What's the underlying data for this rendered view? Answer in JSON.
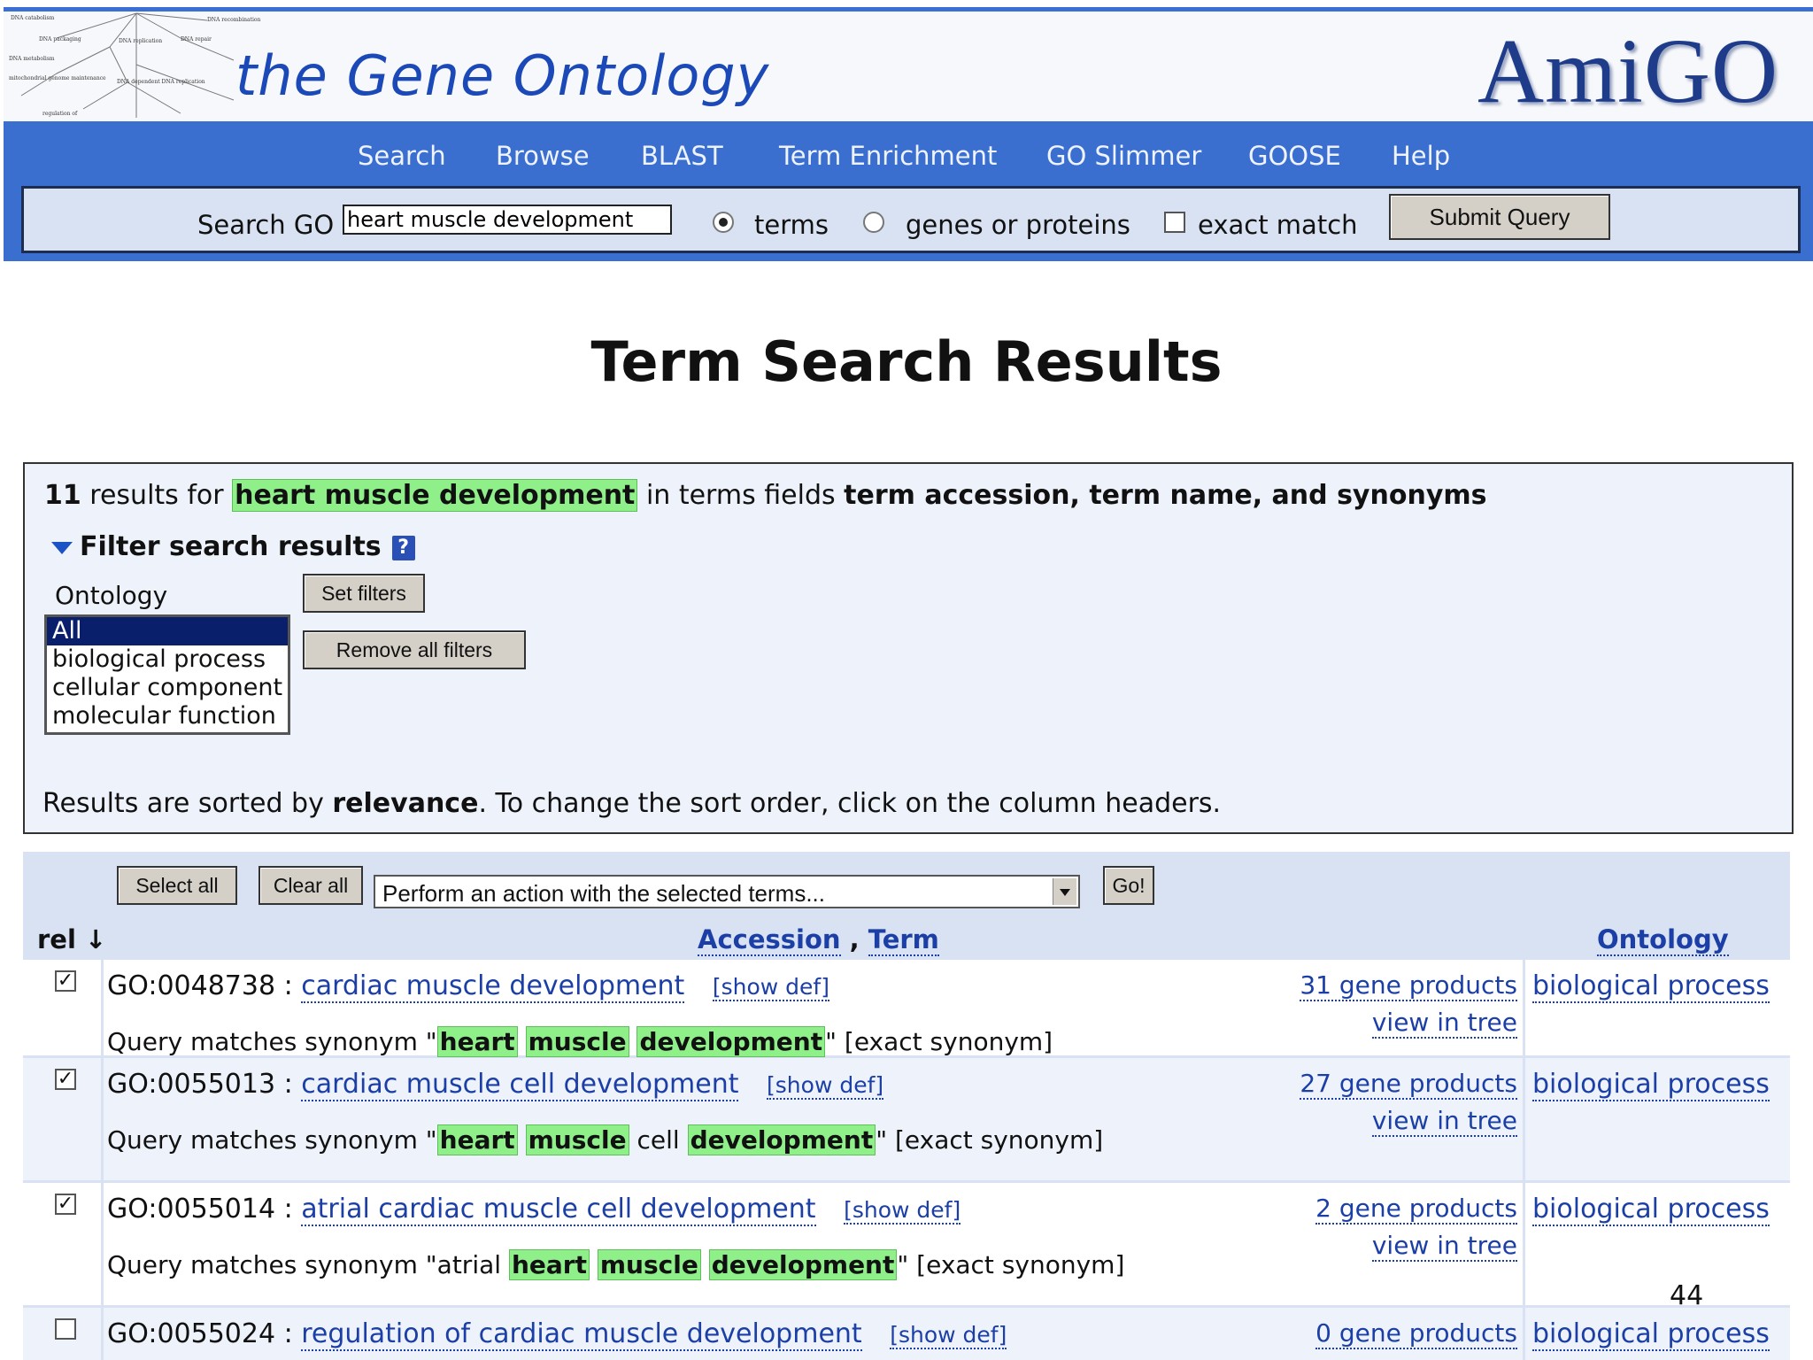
{
  "header": {
    "site_title": "the Gene Ontology",
    "logo": "AmiGO",
    "tree_labels": [
      "DNA catabolism",
      "DNA packaging",
      "DNA replication",
      "DNA metabolism",
      "DNA repair",
      "DNA recombination",
      "mitochondrial genome maintenance",
      "DNA dependent DNA replication",
      "regulation of"
    ]
  },
  "nav": [
    "Search",
    "Browse",
    "BLAST",
    "Term Enrichment",
    "GO Slimmer",
    "GOOSE",
    "Help"
  ],
  "search": {
    "label": "Search GO",
    "query": "heart muscle development",
    "opt_terms": "terms",
    "opt_genes": "genes or proteins",
    "opt_exact": "exact match",
    "submit": "Submit Query"
  },
  "page_title": "Term Search Results",
  "summary": {
    "count": "11",
    "results_for": "results for",
    "query": "heart muscle development",
    "in_fields": "in terms fields",
    "fields": "term accession, term name, and synonyms",
    "filter_head": "Filter search results",
    "help": "?",
    "ontology_label": "Ontology",
    "ontology_options": [
      "All",
      "biological process",
      "cellular component",
      "molecular function"
    ],
    "set_filters": "Set filters",
    "remove_filters": "Remove all filters",
    "sort_prefix": "Results are sorted by",
    "sort_key": "relevance",
    "sort_suffix": ". To change the sort order, click on the column headers."
  },
  "actions": {
    "select_all": "Select all",
    "clear_all": "Clear all",
    "action_placeholder": "Perform an action with the selected terms...",
    "go": "Go!"
  },
  "columns": {
    "rel": "rel ↓",
    "accession": "Accession",
    "comma": ",",
    "term": "Term",
    "ontology": "Ontology"
  },
  "results": [
    {
      "checked": "✓",
      "accession": "GO:0048738 :",
      "term": "cardiac muscle development",
      "show_def": "[show def]",
      "gene_products": "31 gene products",
      "view_tree": "view in tree",
      "ontology": "biological process",
      "match_prefix": "Query matches synonym \"",
      "match_words": [
        "heart",
        "muscle",
        "development"
      ],
      "match_suffix": "\" [exact synonym]"
    },
    {
      "checked": "✓",
      "accession": "GO:0055013 :",
      "term": "cardiac muscle cell development",
      "show_def": "[show def]",
      "gene_products": "27 gene products",
      "view_tree": "view in tree",
      "ontology": "biological process",
      "match_prefix": "Query matches synonym \"",
      "match_words": [
        "heart",
        "muscle",
        "cell",
        "development"
      ],
      "match_suffix": "\" [exact synonym]"
    },
    {
      "checked": "✓",
      "accession": "GO:0055014 :",
      "term": "atrial cardiac muscle cell development",
      "show_def": "[show def]",
      "gene_products": "2 gene products",
      "view_tree": "view in tree",
      "ontology": "biological process",
      "match_prefix": "Query matches synonym \"atrial ",
      "match_words": [
        "heart",
        "muscle",
        "development"
      ],
      "match_suffix": "\" [exact synonym]"
    },
    {
      "checked": "",
      "accession": "GO:0055024 :",
      "term": "regulation of cardiac muscle development",
      "show_def": "[show def]",
      "gene_products": "0 gene products",
      "ontology": "biological process"
    }
  ],
  "page_number": "44",
  "colors": {
    "nav_blue": "#3a6fd0",
    "panel": "#d8e2f2",
    "highlight": "#8ff08a",
    "link": "#1b3fa6",
    "logo": "#1e3c8a"
  }
}
